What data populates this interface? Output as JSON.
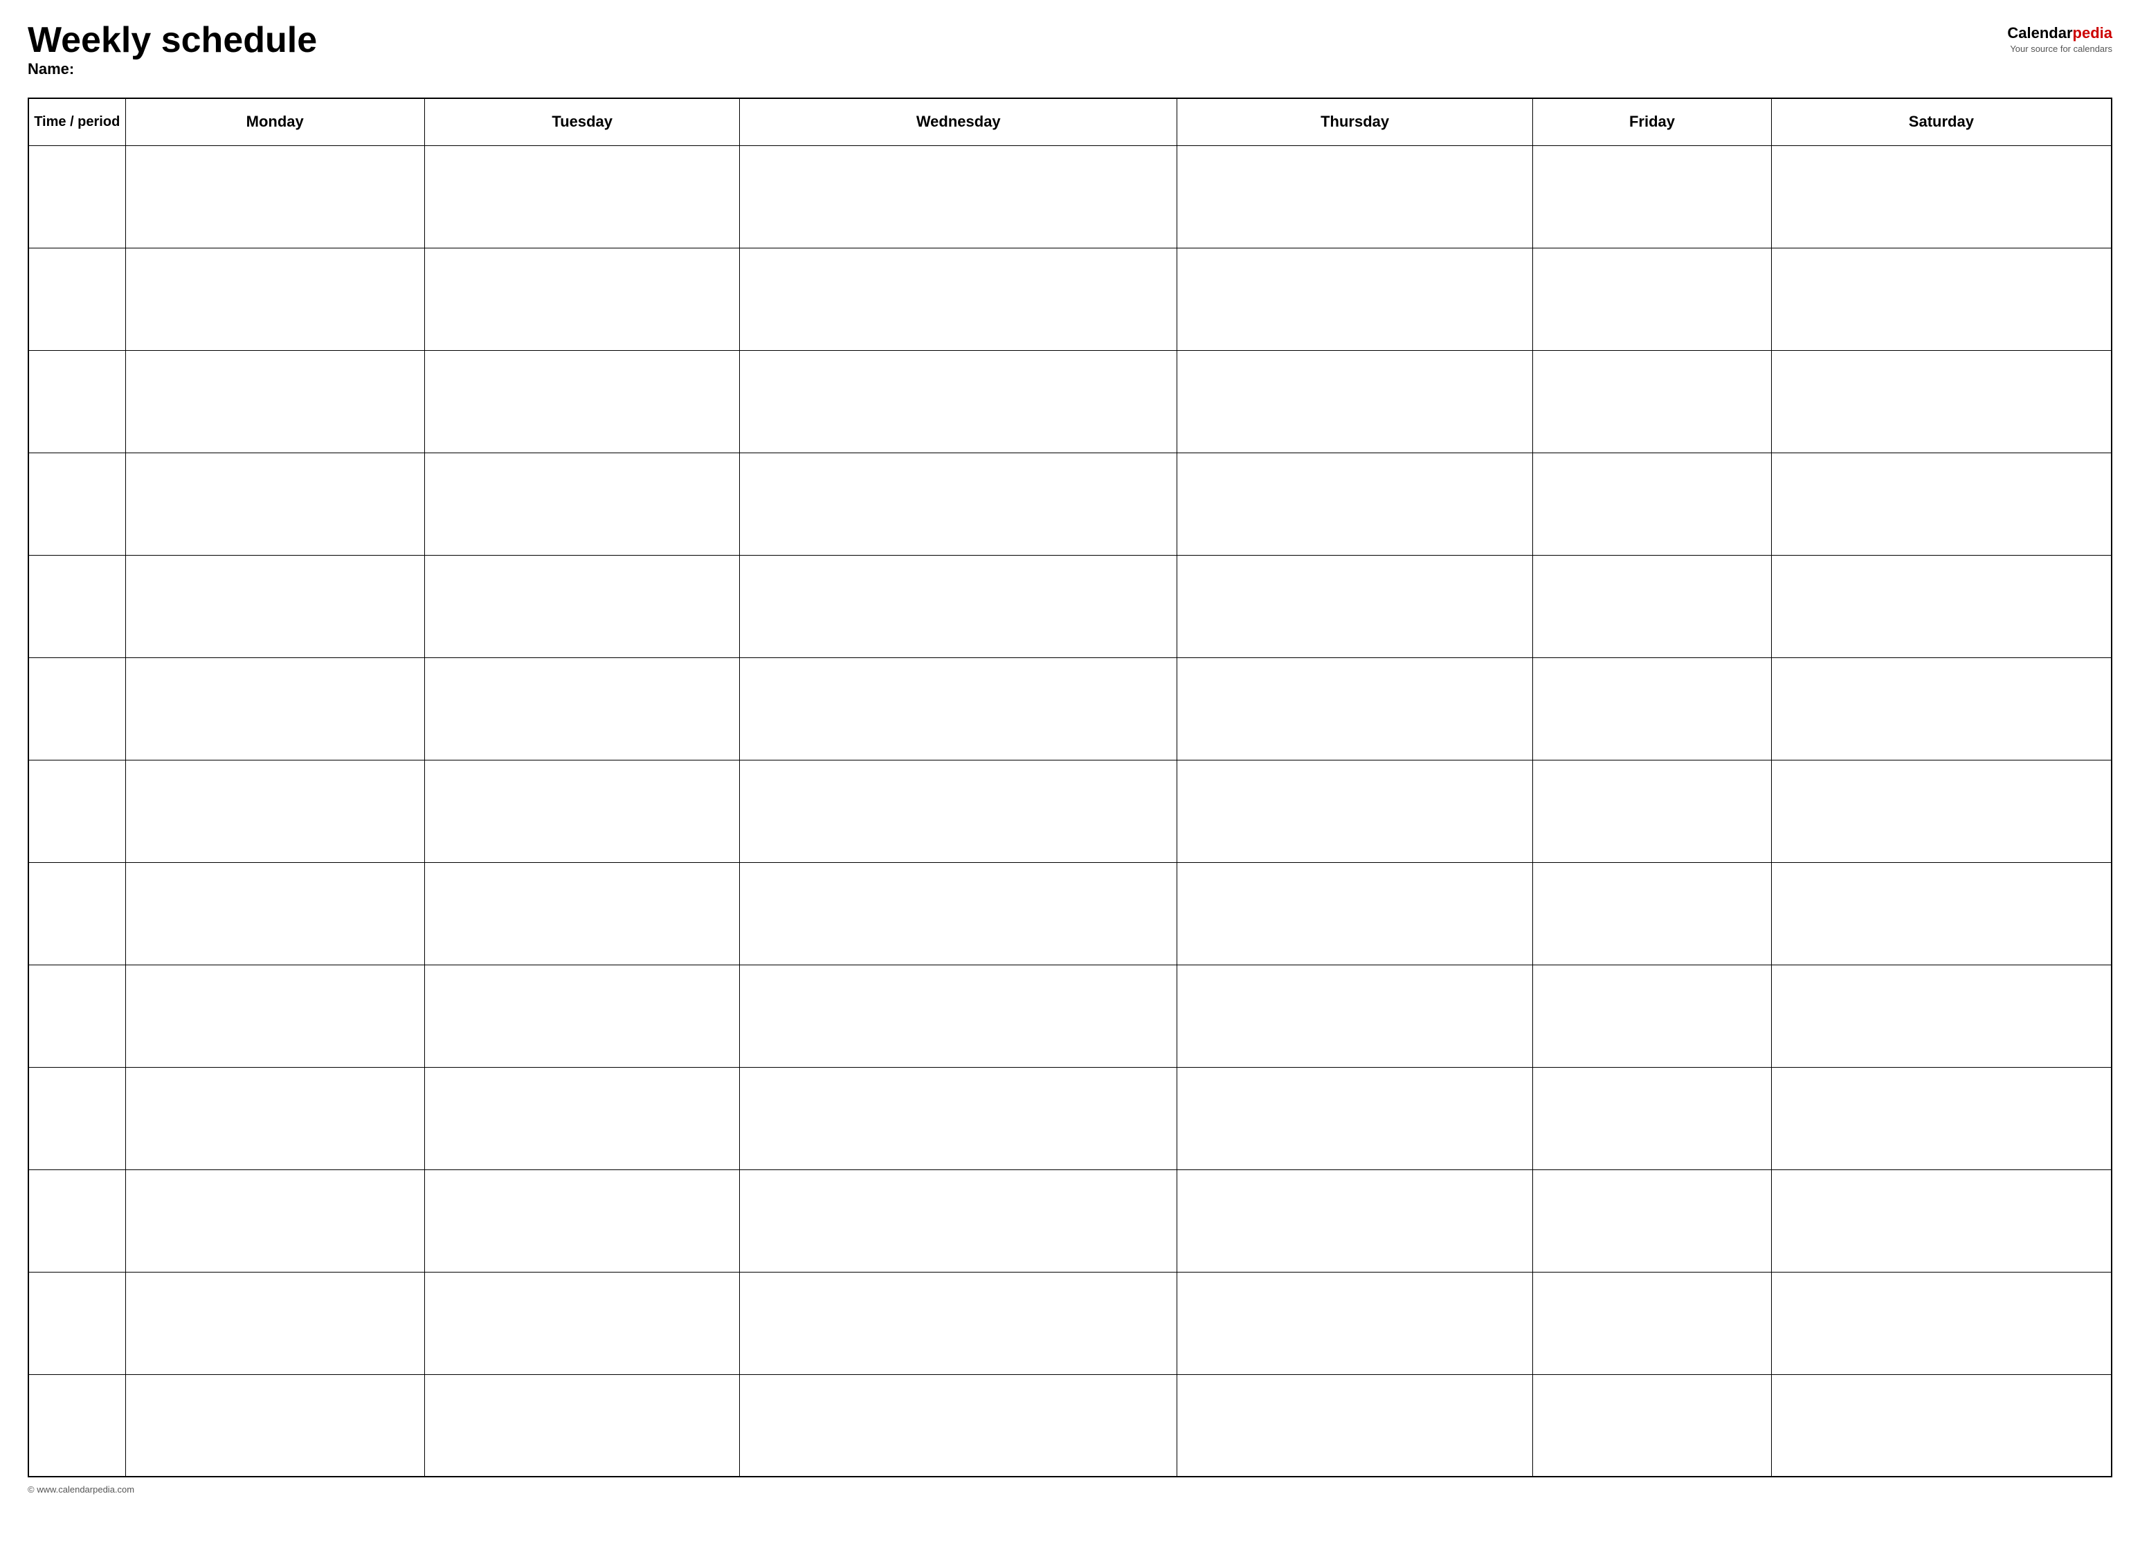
{
  "header": {
    "title": "Weekly schedule",
    "name_label": "Name:",
    "logo": {
      "calendar": "Calendar",
      "pedia": "pedia",
      "tagline": "Your source for calendars"
    }
  },
  "table": {
    "columns": [
      {
        "id": "time",
        "label": "Time / period"
      },
      {
        "id": "monday",
        "label": "Monday"
      },
      {
        "id": "tuesday",
        "label": "Tuesday"
      },
      {
        "id": "wednesday",
        "label": "Wednesday"
      },
      {
        "id": "thursday",
        "label": "Thursday"
      },
      {
        "id": "friday",
        "label": "Friday"
      },
      {
        "id": "saturday",
        "label": "Saturday"
      }
    ],
    "row_count": 13
  },
  "footer": {
    "text": "© www.calendarpedia.com"
  }
}
